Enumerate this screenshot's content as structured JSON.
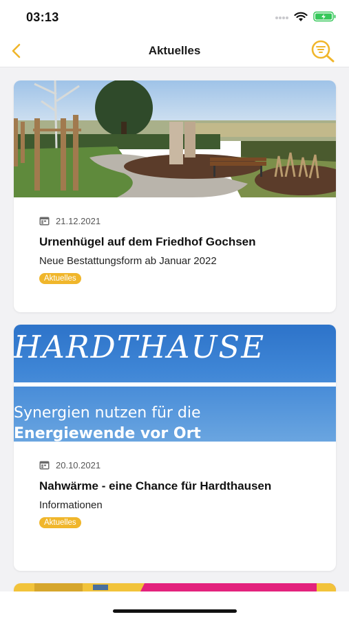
{
  "status_bar": {
    "time": "03:13"
  },
  "nav": {
    "title": "Aktuelles"
  },
  "colors": {
    "accent": "#f0b62b",
    "battery": "#35c759"
  },
  "articles": [
    {
      "date": "21.12.2021",
      "title": "Urnenhügel auf dem Friedhof Gochsen",
      "subtitle": "Neue Bestattungsform ab Januar 2022",
      "tag": "Aktuelles"
    },
    {
      "date": "20.10.2021",
      "title": "Nahwärme - eine Chance für Hardthausen",
      "subtitle": "Informationen",
      "tag": "Aktuelles",
      "image_text": {
        "headline": "HARDTHAUSE",
        "line1": "Synergien nutzen für die",
        "line2": "Energiewende vor Ort"
      }
    }
  ],
  "icons": {
    "back": "chevron-left-icon",
    "filter": "search-filter-icon",
    "date": "calendar-icon"
  }
}
